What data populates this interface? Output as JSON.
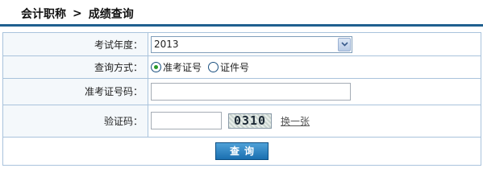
{
  "breadcrumb": {
    "section": "会计职称",
    "separator": ">",
    "current": "成绩查询"
  },
  "form": {
    "year": {
      "label": "考试年度：",
      "selected": "2013"
    },
    "method": {
      "label": "查询方式：",
      "options": [
        {
          "label": "准考证号",
          "checked": true
        },
        {
          "label": "证件号",
          "checked": false
        }
      ]
    },
    "ticket": {
      "label": "准考证号码：",
      "value": ""
    },
    "captcha": {
      "label": "验证码：",
      "value": "",
      "image_text": "0310",
      "refresh_label": "换一张"
    },
    "submit_label": "查询"
  },
  "colors": {
    "accent": "#1f5f8f",
    "border": "#a9c3dc",
    "button": "#1a6fb0"
  }
}
